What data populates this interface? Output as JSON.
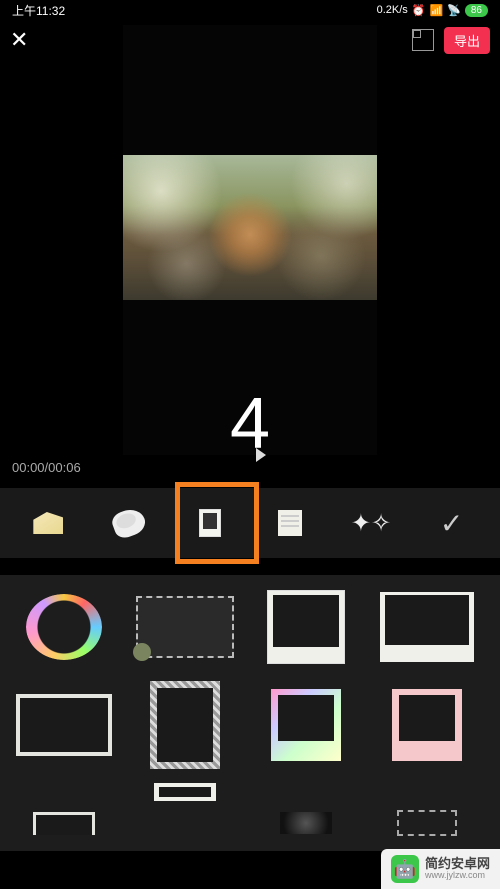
{
  "status": {
    "time": "上午11:32",
    "net": "0.2K/s",
    "icons": "⏰ 📶 📶 📡",
    "battery": "86"
  },
  "topbar": {
    "export_label": "导出"
  },
  "preview": {
    "countdown": "4"
  },
  "timeline": {
    "current": "00:00",
    "total": "00:06"
  },
  "categories": [
    {
      "name": "cheese"
    },
    {
      "name": "banana"
    },
    {
      "name": "polaroid"
    },
    {
      "name": "notepad"
    },
    {
      "name": "sparkle"
    },
    {
      "name": "confirm"
    }
  ],
  "frames": [
    {
      "name": "emoji-wreath"
    },
    {
      "name": "ticket-stamp"
    },
    {
      "name": "polaroid-portrait"
    },
    {
      "name": "polaroid-landscape"
    },
    {
      "name": "thick-white"
    },
    {
      "name": "newspaper"
    },
    {
      "name": "holographic"
    },
    {
      "name": "pink-polaroid"
    },
    {
      "name": "tab-white"
    },
    {
      "name": "tab-paper"
    },
    {
      "name": "radial-dark"
    },
    {
      "name": "dashed"
    }
  ],
  "watermark": {
    "title": "简约安卓网",
    "url": "www.jylzw.com"
  }
}
